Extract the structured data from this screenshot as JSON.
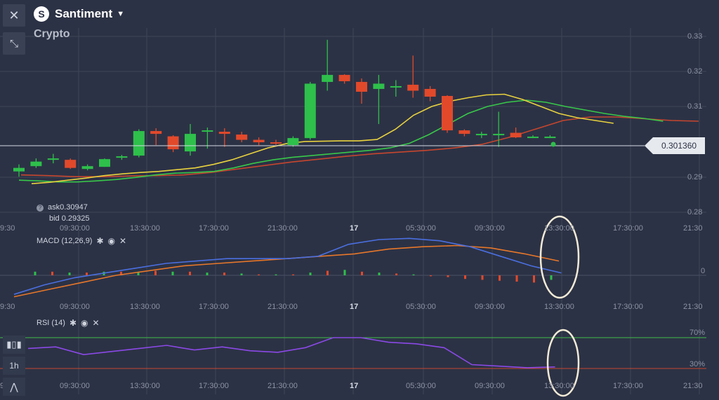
{
  "left_toolbar": {
    "close_icon": "close-icon",
    "resize_icon": "collapse-arrows-icon"
  },
  "header": {
    "asset_name": "Santiment",
    "category": "Crypto",
    "logo_icon": "santiment-logo-icon",
    "dropdown_icon": "caret-down-icon"
  },
  "price_axis": {
    "labels": [
      "0.33",
      "0.32",
      "0.31",
      "0.29",
      "0.28"
    ]
  },
  "current_price": "0.301360",
  "quote": {
    "ask_label": "ask",
    "ask_value": "0.30947",
    "bid_label": "bid",
    "bid_value": "0.29325"
  },
  "time_axis": {
    "labels": [
      "9:30",
      "09:30:00",
      "13:30:00",
      "17:30:00",
      "21:30:00",
      "17",
      "05:30:00",
      "09:30:00",
      "13:30:00",
      "17:30:00",
      "21:30"
    ]
  },
  "macd": {
    "title": "MACD (12,26,9)",
    "zero_label": "0"
  },
  "rsi": {
    "title": "RSI (14)",
    "level_70": "70%",
    "level_30": "30%"
  },
  "bottom_tools": {
    "timeframe": "1h"
  },
  "colors": {
    "background": "#2c3245",
    "bull": "#2ec04b",
    "bear": "#e2492b",
    "ma_yellow": "#e9d23e",
    "ma_green": "#38c84a",
    "ma_red": "#c6462e",
    "macd_blue": "#4a6fe0",
    "macd_orange": "#e7772a",
    "rsi_purple": "#8a49e6",
    "highlight_circle": "#f2ead6"
  },
  "chart_data": {
    "type": "candlestick",
    "y_range": [
      0.275,
      0.335
    ],
    "candles": [
      {
        "o": 0.2915,
        "h": 0.2935,
        "l": 0.29,
        "c": 0.2925
      },
      {
        "o": 0.293,
        "h": 0.2952,
        "l": 0.2925,
        "c": 0.2943
      },
      {
        "o": 0.295,
        "h": 0.2965,
        "l": 0.2938,
        "c": 0.2952
      },
      {
        "o": 0.2948,
        "h": 0.2952,
        "l": 0.2922,
        "c": 0.2925
      },
      {
        "o": 0.2922,
        "h": 0.2935,
        "l": 0.2918,
        "c": 0.293
      },
      {
        "o": 0.2928,
        "h": 0.2952,
        "l": 0.2928,
        "c": 0.295
      },
      {
        "o": 0.2955,
        "h": 0.2962,
        "l": 0.2948,
        "c": 0.2958
      },
      {
        "o": 0.296,
        "h": 0.3035,
        "l": 0.2955,
        "c": 0.303
      },
      {
        "o": 0.303,
        "h": 0.3038,
        "l": 0.299,
        "c": 0.3022
      },
      {
        "o": 0.3015,
        "h": 0.3018,
        "l": 0.297,
        "c": 0.2978
      },
      {
        "o": 0.2972,
        "h": 0.305,
        "l": 0.296,
        "c": 0.3022
      },
      {
        "o": 0.3028,
        "h": 0.304,
        "l": 0.298,
        "c": 0.3032
      },
      {
        "o": 0.3028,
        "h": 0.3038,
        "l": 0.2985,
        "c": 0.3022
      },
      {
        "o": 0.302,
        "h": 0.3028,
        "l": 0.2998,
        "c": 0.3005
      },
      {
        "o": 0.3005,
        "h": 0.3012,
        "l": 0.299,
        "c": 0.2998
      },
      {
        "o": 0.2998,
        "h": 0.3005,
        "l": 0.299,
        "c": 0.2995
      },
      {
        "o": 0.299,
        "h": 0.3015,
        "l": 0.2985,
        "c": 0.301
      },
      {
        "o": 0.301,
        "h": 0.317,
        "l": 0.3005,
        "c": 0.3165
      },
      {
        "o": 0.317,
        "h": 0.329,
        "l": 0.3145,
        "c": 0.319
      },
      {
        "o": 0.319,
        "h": 0.3192,
        "l": 0.3165,
        "c": 0.3172
      },
      {
        "o": 0.317,
        "h": 0.318,
        "l": 0.3108,
        "c": 0.3142
      },
      {
        "o": 0.315,
        "h": 0.319,
        "l": 0.305,
        "c": 0.3165
      },
      {
        "o": 0.3158,
        "h": 0.3175,
        "l": 0.3128,
        "c": 0.3158
      },
      {
        "o": 0.3162,
        "h": 0.3245,
        "l": 0.3125,
        "c": 0.3145
      },
      {
        "o": 0.315,
        "h": 0.3158,
        "l": 0.3115,
        "c": 0.3128
      },
      {
        "o": 0.313,
        "h": 0.3132,
        "l": 0.3025,
        "c": 0.3032
      },
      {
        "o": 0.3032,
        "h": 0.3035,
        "l": 0.3015,
        "c": 0.3022
      },
      {
        "o": 0.3018,
        "h": 0.3028,
        "l": 0.301,
        "c": 0.3022
      },
      {
        "o": 0.302,
        "h": 0.3085,
        "l": 0.2985,
        "c": 0.3022
      },
      {
        "o": 0.3025,
        "h": 0.304,
        "l": 0.301,
        "c": 0.3012
      },
      {
        "o": 0.3012,
        "h": 0.3018,
        "l": 0.301,
        "c": 0.3014
      },
      {
        "o": 0.3014,
        "h": 0.3018,
        "l": 0.301,
        "c": 0.3014
      }
    ],
    "ma_yellow": [
      0.288,
      0.2884,
      0.289,
      0.2896,
      0.2903,
      0.2908,
      0.2912,
      0.2915,
      0.292,
      0.2925,
      0.2935,
      0.2948,
      0.2965,
      0.2982,
      0.2994,
      0.3,
      0.3001,
      0.3002,
      0.3002,
      0.3006,
      0.3035,
      0.3075,
      0.31,
      0.3115,
      0.3125,
      0.3133,
      0.3135,
      0.312,
      0.31,
      0.308,
      0.3068,
      0.306,
      0.3052
    ],
    "ma_green": [
      0.289,
      0.2888,
      0.2885,
      0.2885,
      0.2888,
      0.2892,
      0.2898,
      0.2905,
      0.291,
      0.2912,
      0.2915,
      0.2925,
      0.2938,
      0.2948,
      0.2955,
      0.296,
      0.2965,
      0.297,
      0.2975,
      0.2982,
      0.2995,
      0.302,
      0.305,
      0.308,
      0.31,
      0.3112,
      0.3118,
      0.3112,
      0.31,
      0.309,
      0.308,
      0.3072,
      0.3066,
      0.3058
    ],
    "ma_red": [
      0.2905,
      0.2903,
      0.29,
      0.29,
      0.2902,
      0.2903,
      0.2905,
      0.2912,
      0.2922,
      0.2932,
      0.2942,
      0.295,
      0.2958,
      0.2965,
      0.297,
      0.2975,
      0.2982,
      0.2992,
      0.3012,
      0.3036,
      0.306,
      0.307,
      0.307,
      0.3065,
      0.306,
      0.3058
    ],
    "macd_histogram": [
      0.4,
      0.4,
      0.3,
      0.3,
      0.4,
      0.4,
      0.4,
      0.5,
      0.4,
      0.4,
      0.3,
      0.3,
      0.2,
      0.1,
      0.1,
      0.1,
      0.3,
      0.5,
      0.6,
      0.4,
      0.3,
      0.2,
      0.1,
      -0.1,
      -0.2,
      -0.4,
      -0.5,
      -0.6,
      -0.7,
      -0.8,
      -0.5
    ],
    "macd_line": [
      -0.8,
      -0.4,
      -0.1,
      0.1,
      0.3,
      0.5,
      0.6,
      0.7,
      0.7,
      0.7,
      0.8,
      1.3,
      1.5,
      1.55,
      1.45,
      1.2,
      0.8,
      0.4,
      0.1
    ],
    "signal_line": [
      -0.9,
      -0.6,
      -0.3,
      0.0,
      0.2,
      0.4,
      0.5,
      0.6,
      0.7,
      0.8,
      0.9,
      1.1,
      1.2,
      1.25,
      1.15,
      0.9,
      0.6
    ],
    "rsi": [
      56,
      58,
      48,
      52,
      56,
      60,
      54,
      58,
      53,
      51,
      57,
      70,
      70,
      64,
      62,
      57,
      35,
      33,
      31,
      32
    ]
  }
}
